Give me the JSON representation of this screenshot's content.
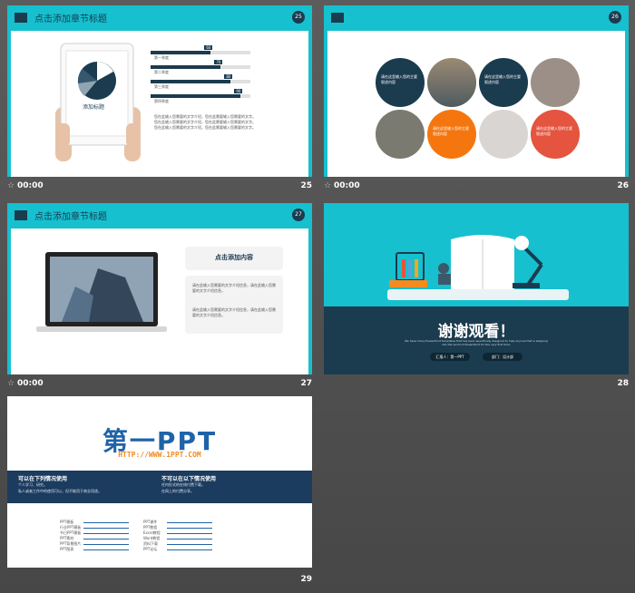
{
  "slides": {
    "s25": {
      "title": "点击添加章节标题",
      "badge": "25",
      "time": "00:00",
      "num": "25",
      "tablet_label": "添加标题",
      "bars": [
        {
          "label": "第一季度",
          "tag": "60",
          "pct": 0.6
        },
        {
          "label": "第二季度",
          "tag": "70",
          "pct": 0.7
        },
        {
          "label": "第三季度",
          "tag": "80",
          "pct": 0.8
        },
        {
          "label": "第四季度",
          "tag": "90",
          "pct": 0.9
        }
      ],
      "body": "您在此输入您需要的文字介绍，您在此需要输入您需要的文字。您在此输入您需要的文字介绍，您在此需要输入您需要的文字。您在此输入您需要的文字介绍，您在此需要输入您需要的文字。"
    },
    "s26": {
      "badge": "26",
      "time": "00:00",
      "num": "26",
      "circle_text": "请在这里输入您的主要叙述内容"
    },
    "s27": {
      "title": "点击添加章节标题",
      "badge": "27",
      "time": "00:00",
      "num": "27",
      "card_title": "点击添加内容",
      "card_p1": "请在此输入您需要的文字介绍信息，请在此输入您需要的文字介绍信息。",
      "card_p2": "请在此输入您需要的文字介绍信息，请在此输入您需要的文字介绍信息。"
    },
    "s28": {
      "num": "28",
      "thanks": "谢谢观看！",
      "sub": "We have many PowerPoint templates that has been specifically designed to help anyone that is stepping into the world of PowerPoint for the very first time.",
      "btn1": "汇报人：第一PPT",
      "btn2": "部门：设计部"
    },
    "s29": {
      "num": "29",
      "logo": "第一PPT",
      "url": "HTTP://WWW.1PPT.COM",
      "can_title": "可以在下列情况使用",
      "can_items": [
        "个人学习、研究。",
        "私人或者工作中的使用可以，但不能用于商业用途。"
      ],
      "cannot_title": "不可以在以下情况使用",
      "cannot_items": [
        "任何形式的在线付费下载。",
        "在网上的付费分享。"
      ],
      "links_left": [
        "PPT模板",
        "行业PPT模板",
        "节日PPT模板",
        "PPT素材",
        "PPT背景图片",
        "PPT图表"
      ],
      "links_right": [
        "PPT课件",
        "PPT教程",
        "Excel教程",
        "Word教程",
        "资料下载",
        "PPT论坛"
      ]
    }
  },
  "colors": {
    "cyan": "#16c0cf",
    "navy": "#1b3b4f",
    "orange": "#f28b22",
    "red": "#e4543e"
  }
}
